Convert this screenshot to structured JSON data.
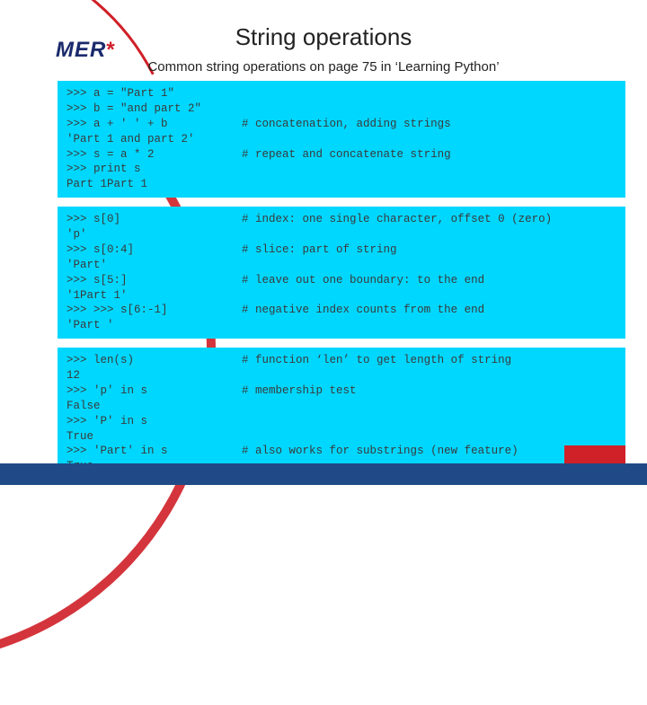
{
  "logo": {
    "text": "MER",
    "star": "*"
  },
  "title": "String operations",
  "subtitle": "Common string operations on page 75 in ‘Learning Python’",
  "code": {
    "block1": ">>> a = \"Part 1\"\n>>> b = \"and part 2\"\n>>> a + ' ' + b           # concatenation, adding strings\n'Part 1 and part 2'\n>>> s = a * 2             # repeat and concatenate string\n>>> print s\nPart 1Part 1",
    "block2": ">>> s[0]                  # index: one single character, offset 0 (zero)\n'p'\n>>> s[0:4]                # slice: part of string\n'Part'\n>>> s[5:]                 # leave out one boundary: to the end\n'1Part 1'\n>>> >>> s[6:-1]           # negative index counts from the end\n'Part '",
    "block3": ">>> len(s)                # function ‘len’ to get length of string\n12\n>>> 'p' in s              # membership test\nFalse\n>>> 'P' in s\nTrue\n>>> 'Part' in s           # also works for substrings (new feature)\nTrue"
  }
}
